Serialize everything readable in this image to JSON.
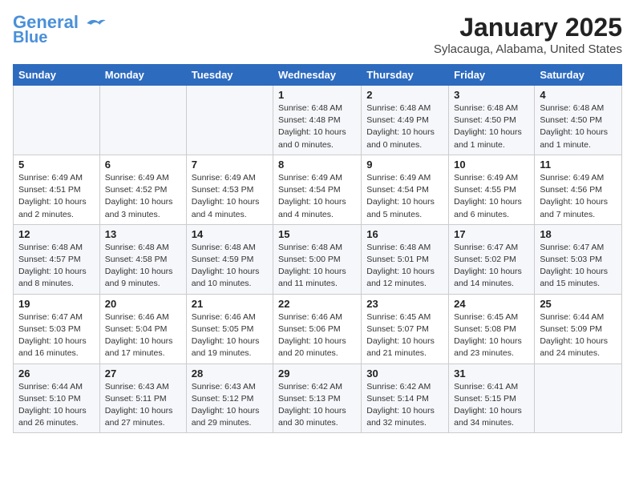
{
  "header": {
    "logo_line1": "General",
    "logo_line2": "Blue",
    "month": "January 2025",
    "location": "Sylacauga, Alabama, United States"
  },
  "weekdays": [
    "Sunday",
    "Monday",
    "Tuesday",
    "Wednesday",
    "Thursday",
    "Friday",
    "Saturday"
  ],
  "weeks": [
    [
      {
        "day": "",
        "detail": ""
      },
      {
        "day": "",
        "detail": ""
      },
      {
        "day": "",
        "detail": ""
      },
      {
        "day": "1",
        "detail": "Sunrise: 6:48 AM\nSunset: 4:48 PM\nDaylight: 10 hours\nand 0 minutes."
      },
      {
        "day": "2",
        "detail": "Sunrise: 6:48 AM\nSunset: 4:49 PM\nDaylight: 10 hours\nand 0 minutes."
      },
      {
        "day": "3",
        "detail": "Sunrise: 6:48 AM\nSunset: 4:50 PM\nDaylight: 10 hours\nand 1 minute."
      },
      {
        "day": "4",
        "detail": "Sunrise: 6:48 AM\nSunset: 4:50 PM\nDaylight: 10 hours\nand 1 minute."
      }
    ],
    [
      {
        "day": "5",
        "detail": "Sunrise: 6:49 AM\nSunset: 4:51 PM\nDaylight: 10 hours\nand 2 minutes."
      },
      {
        "day": "6",
        "detail": "Sunrise: 6:49 AM\nSunset: 4:52 PM\nDaylight: 10 hours\nand 3 minutes."
      },
      {
        "day": "7",
        "detail": "Sunrise: 6:49 AM\nSunset: 4:53 PM\nDaylight: 10 hours\nand 4 minutes."
      },
      {
        "day": "8",
        "detail": "Sunrise: 6:49 AM\nSunset: 4:54 PM\nDaylight: 10 hours\nand 4 minutes."
      },
      {
        "day": "9",
        "detail": "Sunrise: 6:49 AM\nSunset: 4:54 PM\nDaylight: 10 hours\nand 5 minutes."
      },
      {
        "day": "10",
        "detail": "Sunrise: 6:49 AM\nSunset: 4:55 PM\nDaylight: 10 hours\nand 6 minutes."
      },
      {
        "day": "11",
        "detail": "Sunrise: 6:49 AM\nSunset: 4:56 PM\nDaylight: 10 hours\nand 7 minutes."
      }
    ],
    [
      {
        "day": "12",
        "detail": "Sunrise: 6:48 AM\nSunset: 4:57 PM\nDaylight: 10 hours\nand 8 minutes."
      },
      {
        "day": "13",
        "detail": "Sunrise: 6:48 AM\nSunset: 4:58 PM\nDaylight: 10 hours\nand 9 minutes."
      },
      {
        "day": "14",
        "detail": "Sunrise: 6:48 AM\nSunset: 4:59 PM\nDaylight: 10 hours\nand 10 minutes."
      },
      {
        "day": "15",
        "detail": "Sunrise: 6:48 AM\nSunset: 5:00 PM\nDaylight: 10 hours\nand 11 minutes."
      },
      {
        "day": "16",
        "detail": "Sunrise: 6:48 AM\nSunset: 5:01 PM\nDaylight: 10 hours\nand 12 minutes."
      },
      {
        "day": "17",
        "detail": "Sunrise: 6:47 AM\nSunset: 5:02 PM\nDaylight: 10 hours\nand 14 minutes."
      },
      {
        "day": "18",
        "detail": "Sunrise: 6:47 AM\nSunset: 5:03 PM\nDaylight: 10 hours\nand 15 minutes."
      }
    ],
    [
      {
        "day": "19",
        "detail": "Sunrise: 6:47 AM\nSunset: 5:03 PM\nDaylight: 10 hours\nand 16 minutes."
      },
      {
        "day": "20",
        "detail": "Sunrise: 6:46 AM\nSunset: 5:04 PM\nDaylight: 10 hours\nand 17 minutes."
      },
      {
        "day": "21",
        "detail": "Sunrise: 6:46 AM\nSunset: 5:05 PM\nDaylight: 10 hours\nand 19 minutes."
      },
      {
        "day": "22",
        "detail": "Sunrise: 6:46 AM\nSunset: 5:06 PM\nDaylight: 10 hours\nand 20 minutes."
      },
      {
        "day": "23",
        "detail": "Sunrise: 6:45 AM\nSunset: 5:07 PM\nDaylight: 10 hours\nand 21 minutes."
      },
      {
        "day": "24",
        "detail": "Sunrise: 6:45 AM\nSunset: 5:08 PM\nDaylight: 10 hours\nand 23 minutes."
      },
      {
        "day": "25",
        "detail": "Sunrise: 6:44 AM\nSunset: 5:09 PM\nDaylight: 10 hours\nand 24 minutes."
      }
    ],
    [
      {
        "day": "26",
        "detail": "Sunrise: 6:44 AM\nSunset: 5:10 PM\nDaylight: 10 hours\nand 26 minutes."
      },
      {
        "day": "27",
        "detail": "Sunrise: 6:43 AM\nSunset: 5:11 PM\nDaylight: 10 hours\nand 27 minutes."
      },
      {
        "day": "28",
        "detail": "Sunrise: 6:43 AM\nSunset: 5:12 PM\nDaylight: 10 hours\nand 29 minutes."
      },
      {
        "day": "29",
        "detail": "Sunrise: 6:42 AM\nSunset: 5:13 PM\nDaylight: 10 hours\nand 30 minutes."
      },
      {
        "day": "30",
        "detail": "Sunrise: 6:42 AM\nSunset: 5:14 PM\nDaylight: 10 hours\nand 32 minutes."
      },
      {
        "day": "31",
        "detail": "Sunrise: 6:41 AM\nSunset: 5:15 PM\nDaylight: 10 hours\nand 34 minutes."
      },
      {
        "day": "",
        "detail": ""
      }
    ]
  ]
}
